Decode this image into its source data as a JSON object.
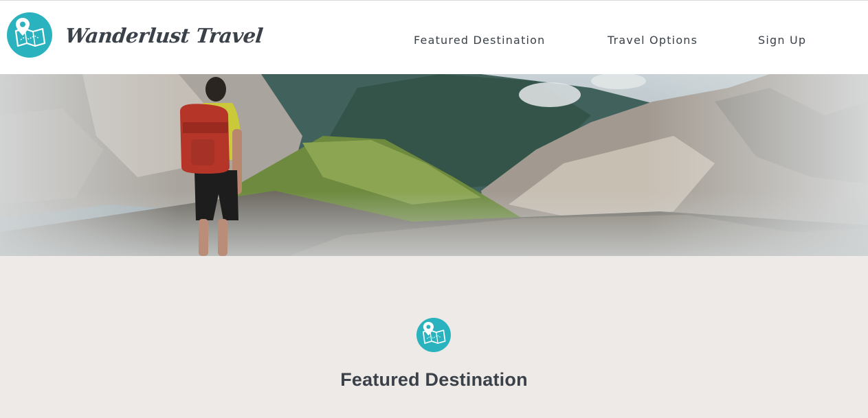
{
  "header": {
    "brand_name": "Wanderlust Travel",
    "logo_icon": "map-pin-icon",
    "nav": {
      "featured": "Featured Destination",
      "options": "Travel Options",
      "signup": "Sign Up"
    }
  },
  "hero": {
    "image": "hiker-on-mountain-ridge"
  },
  "section": {
    "icon": "map-pin-icon",
    "title": "Featured Destination"
  },
  "colors": {
    "accent": "#2ab3bf",
    "text": "#3a4149",
    "section_bg": "#eeeae7"
  }
}
